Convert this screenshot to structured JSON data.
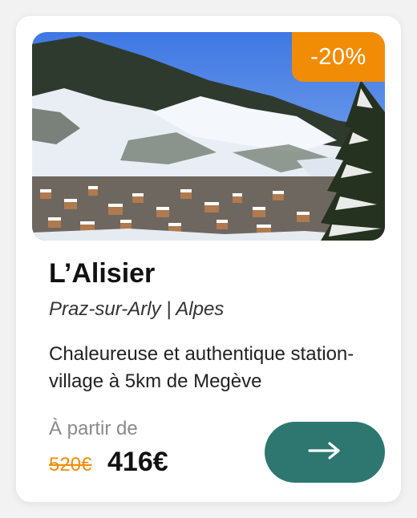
{
  "card": {
    "discount_badge": "-20%",
    "title": "L’Alisier",
    "location": "Praz-sur-Arly | Alpes",
    "description": "Chaleureuse et authentique station-village à 5km de Megève",
    "price_prefix": "À partir de",
    "old_price": "520€",
    "new_price": "416€",
    "cta_icon": "arrow-right-icon"
  },
  "colors": {
    "accent_orange": "#f18c06",
    "cta_teal": "#2e7771",
    "card_background": "#ffffff"
  }
}
